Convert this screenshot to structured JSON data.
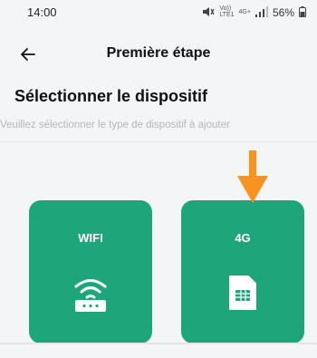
{
  "status_bar": {
    "time": "14:00",
    "network_label_top": "Vo))",
    "network_label_bottom": "LTE1",
    "signal_label": "4G+",
    "battery": "56%",
    "icons": [
      "mute-icon",
      "signal-icon",
      "battery-icon"
    ]
  },
  "header": {
    "back_icon": "arrow-left-icon",
    "title": "Première étape"
  },
  "section": {
    "title": "Sélectionner le dispositif",
    "subtitle": "Veuillez sélectionner le type de dispositif à ajouter"
  },
  "cards": [
    {
      "label": "WIFI",
      "icon": "wifi-router-icon"
    },
    {
      "label": "4G",
      "icon": "sim-card-icon"
    }
  ],
  "colors": {
    "accent": "#1fa57a",
    "annotation_arrow": "#f7931e",
    "background": "#f4f5f7"
  }
}
